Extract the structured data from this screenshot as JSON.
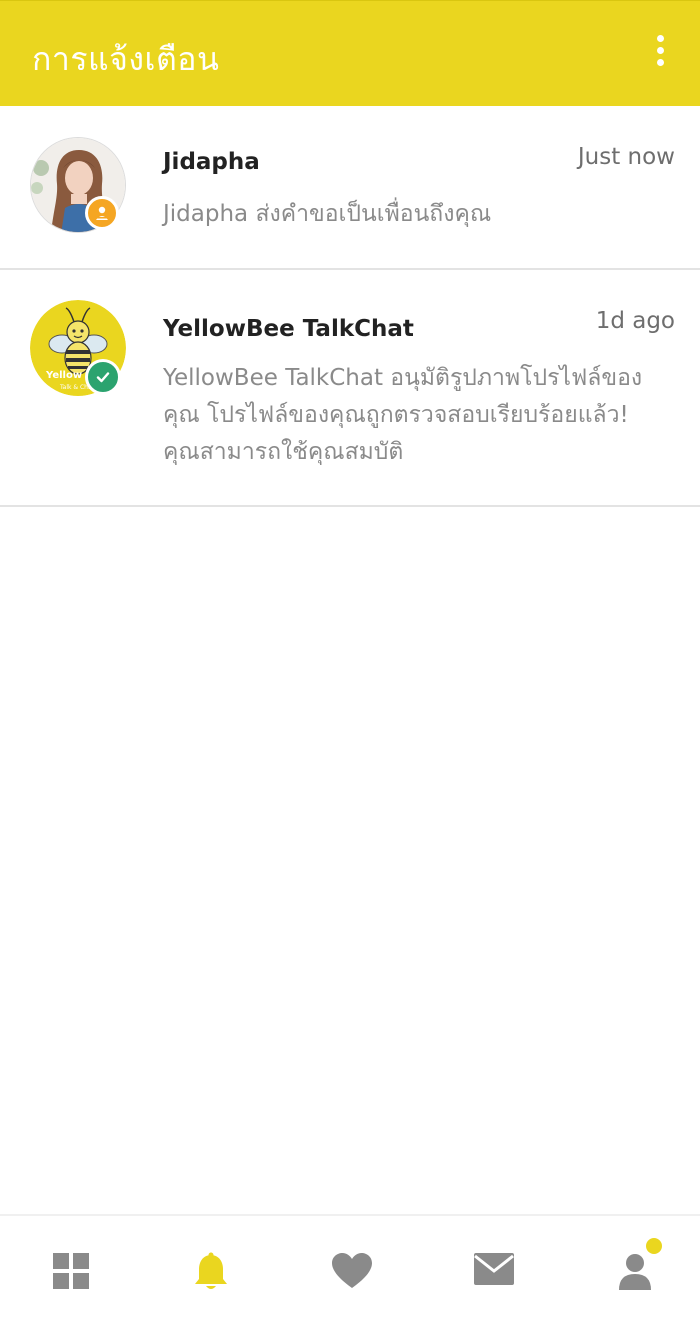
{
  "app_bar": {
    "title": "การแจ้งเตือน",
    "background": "#EAD61F",
    "menu_icon": "more-vert-icon"
  },
  "notifications": [
    {
      "sender": "Jidapha",
      "time": "Just now",
      "message": "Jidapha ส่งคำขอเป็นเพื่อนถึงคุณ",
      "badge_icon": "friend-request-icon",
      "badge_color": "#F5A623"
    },
    {
      "sender": "YellowBee TalkChat",
      "time": "1d ago",
      "message": "YellowBee TalkChat อนุมัติรูปภาพโปรไฟล์ของคุณ โปรไฟล์ของคุณถูกตรวจสอบเรียบร้อยแล้ว! คุณสามารถใช้คุณสมบัติ",
      "avatar_logo_text": "Yellow",
      "avatar_logo_subtext": "Talk & Chat",
      "badge_icon": "verified-check-icon",
      "badge_color": "#2BA36F"
    }
  ],
  "bottom_nav": [
    {
      "icon": "grid-icon",
      "active": false
    },
    {
      "icon": "bell-icon",
      "active": true
    },
    {
      "icon": "heart-icon",
      "active": false
    },
    {
      "icon": "mail-icon",
      "active": false
    },
    {
      "icon": "profile-icon",
      "active": false,
      "has_notification_dot": true
    }
  ],
  "colors": {
    "accent": "#EAD61F",
    "nav_inactive": "#8a8a8a"
  }
}
